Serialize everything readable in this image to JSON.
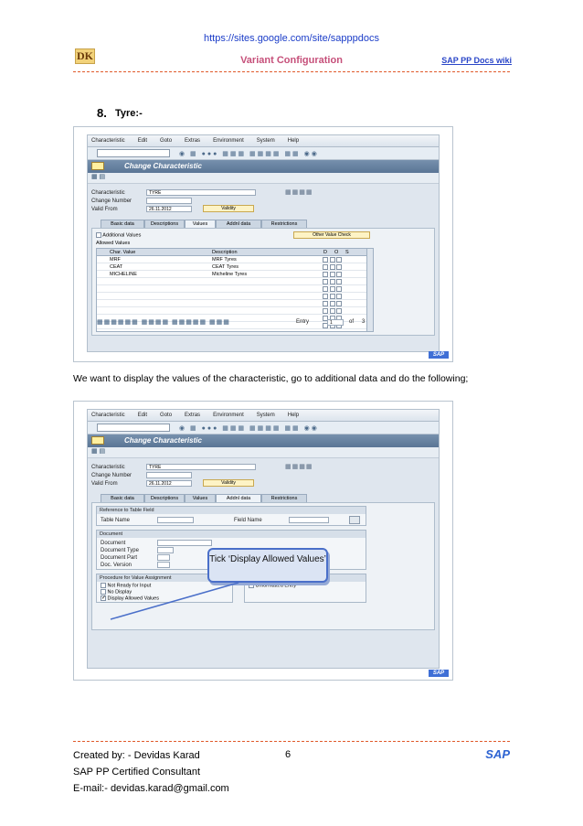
{
  "header": {
    "url": "https://sites.google.com/site/sapppdocs",
    "logo_text": "DK",
    "title": "Variant Configuration",
    "wiki_link": "SAP PP Docs wiki"
  },
  "section": {
    "number": "8.",
    "title": "Tyre:-"
  },
  "paragraph": "We want to display the values of the characteristic, go to additional data and do the following;",
  "sap_common": {
    "menu": [
      "Characteristic",
      "Edit",
      "Goto",
      "Extras",
      "Environment",
      "System",
      "Help"
    ],
    "screen_title": "Change Characteristic",
    "labels": {
      "characteristic": "Characteristic",
      "change_number": "Change Number",
      "valid_from": "Valid From"
    },
    "characteristic_value": "TYRE",
    "valid_from_value": "26.11.2012",
    "validity_button": "Validity",
    "tabs": [
      "Basic data",
      "Descriptions",
      "Values",
      "Addnl data",
      "Restrictions"
    ],
    "sap_logo": "SAP"
  },
  "screenshot1": {
    "additional_values_label": "Additional Values",
    "other_value_check_button": "Other Value Check",
    "allowed_values_title": "Allowed Values",
    "columns": [
      "Char. Value",
      "Description",
      "D",
      "O",
      "S"
    ],
    "rows": [
      {
        "value": "MRF",
        "description": "MRF Tyres"
      },
      {
        "value": "CEAT",
        "description": "CEAT Tyres"
      },
      {
        "value": "MICHELINE",
        "description": "Micheline Tyres"
      }
    ],
    "entry_label": "Entry",
    "entry_value": "1",
    "of_label": "of",
    "total_entries": "3"
  },
  "screenshot2": {
    "ref_table_group": "Reference to Table Field",
    "table_name_label": "Table Name",
    "field_name_label": "Field Name",
    "document_group": "Document",
    "document_labels": [
      "Document",
      "Document Type",
      "Document Part",
      "Doc. Version"
    ],
    "procedure_group": "Procedure for Value Assignment",
    "procedure_options": [
      {
        "label": "Not Ready for Input",
        "checked": false
      },
      {
        "label": "No Display",
        "checked": false
      },
      {
        "label": "Display Allowed Values",
        "checked": true
      }
    ],
    "unformatted_entry_label": "Unformatted Entry",
    "callout_text": "Tick ‘Display Allowed Values’"
  },
  "footer": {
    "created_by": "Created by: - Devidas Karad",
    "certification": "SAP PP Certified Consultant",
    "email": "E-mail:- devidas.karad@gmail.com",
    "page_number": "6",
    "brand": "SAP"
  }
}
